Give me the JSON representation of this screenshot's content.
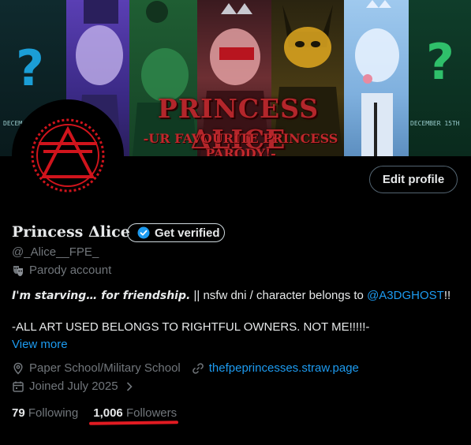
{
  "banner": {
    "title": "PRINCESS ΔLICE",
    "subtitle": "-UR FAVOURITE PRINCESS PARODY!-",
    "date_left": "DECEM",
    "date_right": "DECEMBER 15TH",
    "question_mark": "?"
  },
  "profile": {
    "edit_profile_label": "Edit profile",
    "display_name": "Princess Δlice",
    "get_verified_label": "Get verified",
    "handle": "@_Alice__FPE_",
    "parody_label": "Parody account",
    "bio": {
      "bold_part": "I'm starving… for friendship.",
      "mid_part": " || nsfw dni  / character belongs to ",
      "mention": "@A3DGHOST",
      "end_part": "!!",
      "line2": "-ALL ART USED BELONGS TO RIGHTFUL OWNERS. NOT ME!!!!!-"
    },
    "view_more": "View more",
    "location": "Paper School/Military School",
    "website": "thefpeprincesses.straw.page",
    "joined": "Joined July 2025",
    "following_count": "79",
    "following_label": "Following",
    "followers_count": "1,006",
    "followers_label": "Followers"
  },
  "colors": {
    "accent": "#1d9bf0",
    "highlight_underline": "#e11b22",
    "avatar_red": "#d0141c"
  }
}
